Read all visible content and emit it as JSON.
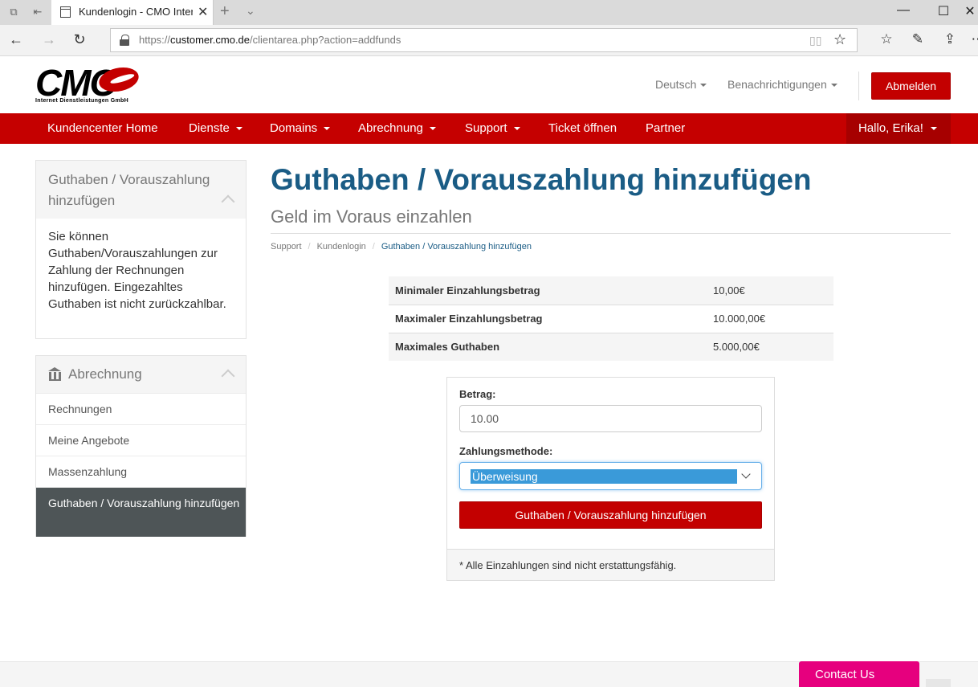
{
  "browser": {
    "tab_title": "Kundenlogin - CMO Internet Dienstleistungen GmbH",
    "url_prefix": "https://",
    "url_host": "customer.cmo.de",
    "url_path": "/clientarea.php?action=addfunds"
  },
  "header": {
    "logo_text": "CMO",
    "logo_subtitle": "Internet Dienstleistungen GmbH",
    "language_label": "Deutsch",
    "notifications_label": "Benachrichtigungen",
    "logout_label": "Abmelden"
  },
  "nav": {
    "items": [
      {
        "label": "Kundencenter Home"
      },
      {
        "label": "Dienste"
      },
      {
        "label": "Domains"
      },
      {
        "label": "Abrechnung"
      },
      {
        "label": "Support"
      },
      {
        "label": "Ticket öffnen"
      },
      {
        "label": "Partner"
      }
    ],
    "user_label": "Hallo, Erika!"
  },
  "sidebar": {
    "info_panel": {
      "title": "Guthaben / Vorauszahlung hinzufügen",
      "body": "Sie können Guthaben/Vorauszahlungen zur Zahlung der Rechnungen hinzufügen. Eingezahltes Guthaben ist nicht zurückzahlbar."
    },
    "billing_panel": {
      "title": "Abrechnung",
      "items": [
        {
          "label": "Rechnungen"
        },
        {
          "label": "Meine Angebote"
        },
        {
          "label": "Massenzahlung"
        },
        {
          "label": "Guthaben / Vorauszahlung hinzufügen"
        }
      ]
    }
  },
  "main": {
    "title": "Guthaben / Vorauszahlung hinzufügen",
    "subtitle": "Geld im Voraus einzahlen",
    "breadcrumb": [
      "Support",
      "Kundenlogin",
      "Guthaben / Vorauszahlung hinzufügen"
    ],
    "limits": [
      {
        "label": "Minimaler Einzahlungsbetrag",
        "value": "10,00€"
      },
      {
        "label": "Maximaler Einzahlungsbetrag",
        "value": "10.000,00€"
      },
      {
        "label": "Maximales Guthaben",
        "value": "5.000,00€"
      }
    ],
    "form": {
      "amount_label": "Betrag:",
      "amount_value": "10.00",
      "method_label": "Zahlungsmethode:",
      "method_selected": "Überweisung",
      "submit_label": "Guthaben / Vorauszahlung hinzufügen",
      "footnote": "* Alle Einzahlungen sind nicht erstattungsfähig."
    }
  },
  "footer": {
    "contact_label": "Contact Us"
  },
  "colors": {
    "brand_red": "#c50000",
    "title_blue": "#1a5c85",
    "contact_pink": "#e6007e",
    "active_sidebar": "#4e5557",
    "select_highlight": "#3a9ad9"
  }
}
